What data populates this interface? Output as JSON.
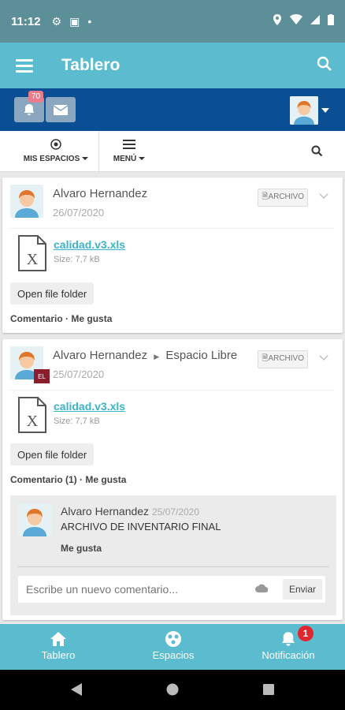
{
  "status_bar": {
    "time": "11:12"
  },
  "app_bar": {
    "title": "Tablero"
  },
  "notifications": {
    "count": "70"
  },
  "tabs": {
    "my_spaces": "MIS ESPACIOS",
    "menu": "MENÚ"
  },
  "posts": [
    {
      "author": "Alvaro Hernandez",
      "space": "",
      "date": "26/07/2020",
      "tag": "ARCHIVO",
      "file_name": "calidad.v3.xls",
      "file_size": "Size: 7,7 kB",
      "folder_button": "Open file folder",
      "comment_link": "Comentario",
      "like_link": "Me gusta"
    },
    {
      "author": "Alvaro Hernandez",
      "space": "Espacio Libre",
      "space_badge": "EL",
      "date": "25/07/2020",
      "tag": "ARCHIVO",
      "file_name": "calidad.v3.xls",
      "file_size": "Size: 7,7 kB",
      "folder_button": "Open file folder",
      "comment_link": "Comentario (1)",
      "like_link": "Me gusta",
      "comment": {
        "author": "Alvaro Hernandez",
        "date": "25/07/2020",
        "text": "ARCHIVO DE INVENTARIO FINAL",
        "like_link": "Me gusta"
      },
      "new_comment_placeholder": "Escribe un nuevo comentario...",
      "send_button": "Enviar"
    }
  ],
  "bottom_nav": [
    {
      "label": "Tablero",
      "icon": "home-icon"
    },
    {
      "label": "Espacios",
      "icon": "spaces-icon"
    },
    {
      "label": "Notificación",
      "icon": "bell-icon",
      "badge": "1"
    }
  ],
  "colors": {
    "app_bar": "#5bbcd0",
    "blue_strip": "#0a4f94",
    "link": "#3bb3c9",
    "badge": "#e12630"
  }
}
